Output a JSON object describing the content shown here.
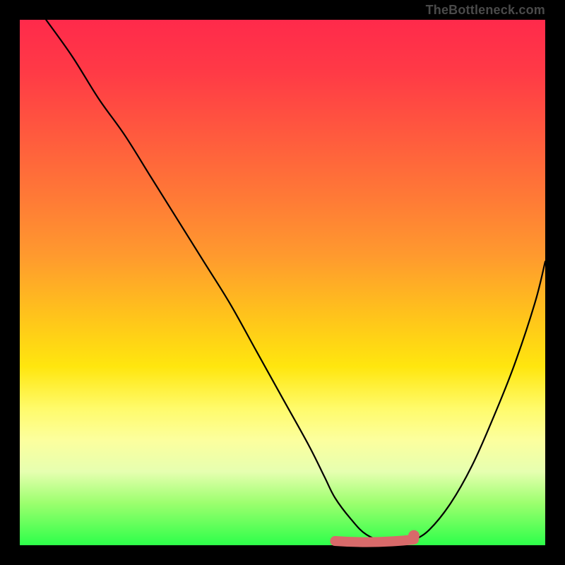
{
  "attribution": "TheBottleneck.com",
  "colors": {
    "highlight": "#d86a6a",
    "curve": "#000000"
  },
  "chart_data": {
    "type": "line",
    "title": "",
    "xlabel": "",
    "ylabel": "",
    "xlim": [
      0,
      100
    ],
    "ylim": [
      0,
      100
    ],
    "grid": false,
    "legend": false,
    "series": [
      {
        "name": "bottleneck-curve",
        "x": [
          5,
          10,
          15,
          20,
          25,
          30,
          35,
          40,
          45,
          50,
          55,
          58,
          60,
          63,
          66,
          70,
          73,
          75,
          78,
          82,
          86,
          90,
          94,
          98,
          100
        ],
        "y": [
          100,
          93,
          85,
          78,
          70,
          62,
          54,
          46,
          37,
          28,
          19,
          13,
          9,
          5,
          2,
          0.5,
          0.5,
          1,
          3,
          8,
          15,
          24,
          34,
          46,
          54
        ]
      }
    ],
    "highlight": {
      "name": "optimal-range",
      "x_start": 60,
      "x_end": 75,
      "marker_x": 75,
      "marker_y": 1
    },
    "background_gradient": {
      "top": "#ff2a4b",
      "mid": "#ffe60e",
      "bottom": "#2dff4a"
    }
  }
}
